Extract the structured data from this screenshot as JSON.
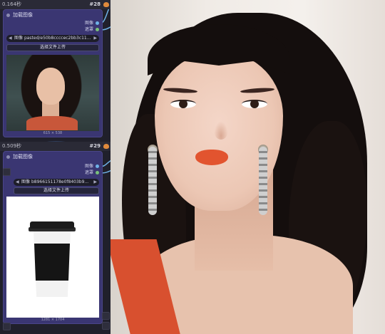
{
  "node1": {
    "time": "0.164秒",
    "id": "#28",
    "title": "加载图像",
    "outputs": [
      "图像",
      "遮罩"
    ],
    "image_combo": {
      "label": "图像",
      "value": "pasted/e50b8ccccec2bb3c11..."
    },
    "upload_label": "选择文件上传",
    "image_size": "615 × 538"
  },
  "node2": {
    "time": "0.509秒",
    "id": "#29",
    "title": "加载图像",
    "outputs": [
      "图像",
      "遮罩"
    ],
    "image_combo": {
      "label": "图像",
      "value": "b8966151178e0f8403b9..."
    },
    "upload_label": "选择文件上传",
    "image_size": "1281 × 1704"
  },
  "colors": {
    "node_body": "#3a3672",
    "image_port": "#6fb3e8",
    "mask_port": "#7ac17a",
    "wire": "#6fb3e8"
  },
  "icons": [
    "fox-icon",
    "node-dot-icon",
    "arrow-left-icon",
    "arrow-right-icon"
  ]
}
